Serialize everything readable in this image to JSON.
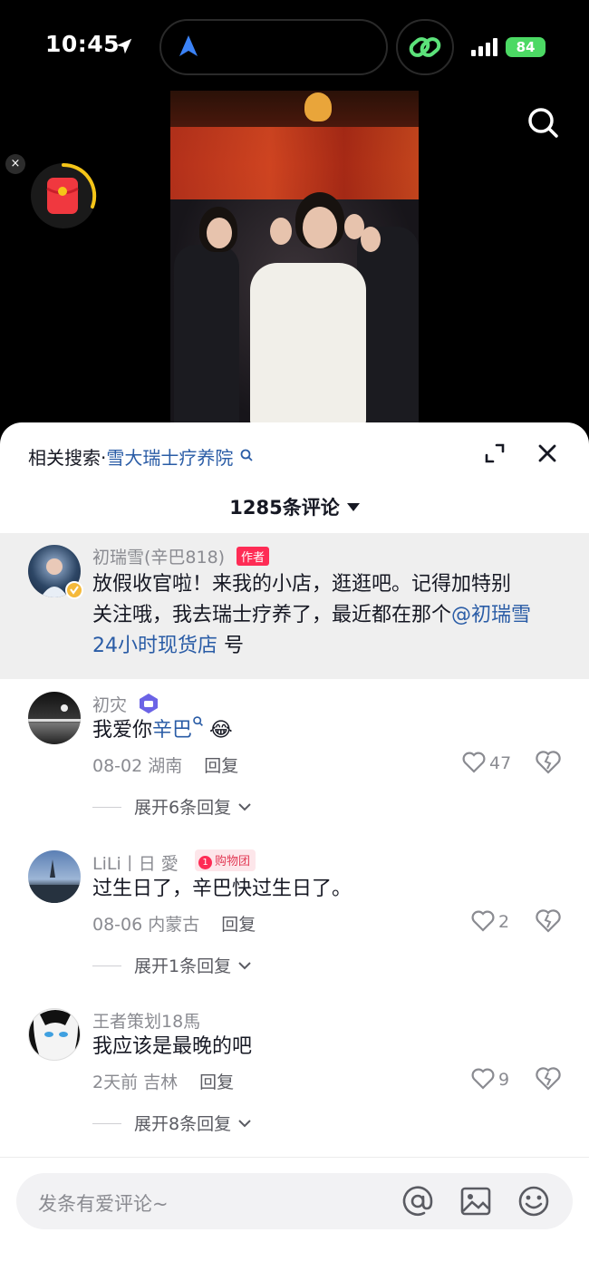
{
  "status_bar": {
    "time": "10:45",
    "battery": "84"
  },
  "colors": {
    "accent_link": "#2a5ca6",
    "author_tag": "#fe2c55",
    "battery": "#4cd964"
  },
  "icons": [
    "location-arrow-icon",
    "navigation-icon",
    "link-icon",
    "signal-icon",
    "search-icon",
    "close-icon",
    "red-packet-icon",
    "expand-icon",
    "heart-icon",
    "dislike-heart-icon",
    "at-icon",
    "image-icon",
    "emoji-icon"
  ],
  "floating": {
    "close_label": "×"
  },
  "sheet": {
    "related_prefix": "相关搜索·",
    "related_query": "雪大瑞士疗养院",
    "comment_count": "1285条评论"
  },
  "comments": [
    {
      "user": "初瑞雪(辛巴818)",
      "tag": "作者",
      "text_line1": "放假收官啦！来我的小店，逛逛吧。记得加特别",
      "text_line2_pre": "关注哦，我去瑞士疗养了，最近都在那个",
      "mention_part1": "@初瑞雪",
      "mention_part2": "24小时现货店",
      "text_tail": " 号"
    },
    {
      "user": "初灾",
      "text": "我爱你",
      "mention": "辛巴",
      "emoji": "😂",
      "date_loc": "08-02 湖南",
      "reply": "回复",
      "likes": "47",
      "expand": "展开6条回复"
    },
    {
      "user": "LiLi丨日 愛",
      "badge_num": "1",
      "badge_text": "购物团",
      "text": "过生日了，辛巴快过生日了。",
      "date_loc": "08-06 内蒙古",
      "reply": "回复",
      "likes": "2",
      "expand": "展开1条回复"
    },
    {
      "user": "王者策划18馬",
      "text": "我应该是最晚的吧",
      "date_loc": "2天前 吉林",
      "reply": "回复",
      "likes": "9",
      "expand": "展开8条回复"
    }
  ],
  "input": {
    "placeholder": "发条有爱评论~"
  }
}
